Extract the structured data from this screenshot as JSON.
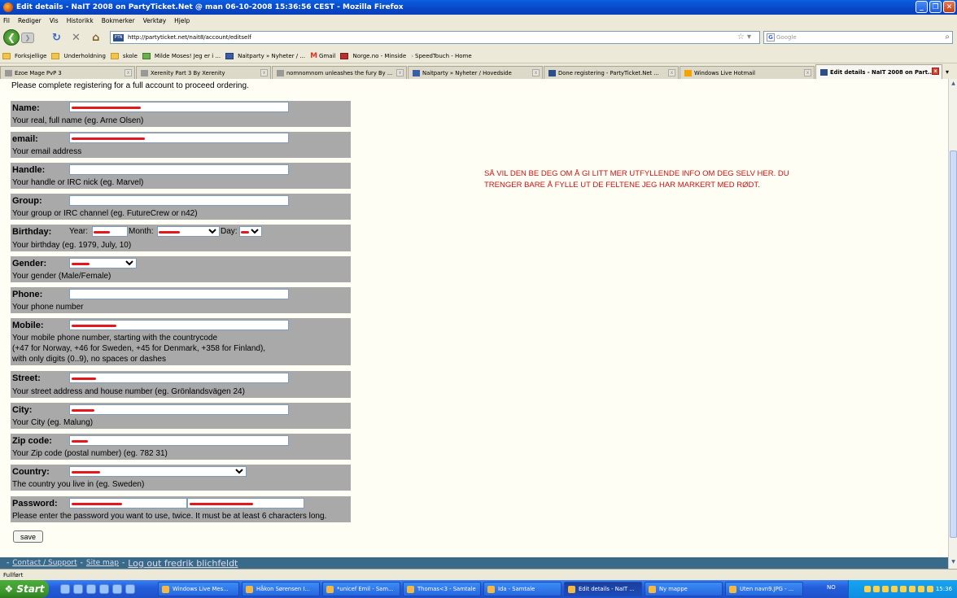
{
  "window": {
    "title": "Edit details - NaIT 2008 on PartyTicket.Net @ man 06-10-2008 15:36:56 CEST - Mozilla Firefox"
  },
  "menu": [
    "Fil",
    "Rediger",
    "Vis",
    "Historikk",
    "Bokmerker",
    "Verktøy",
    "Hjelp"
  ],
  "nav": {
    "url": "http://partyticket.net/nait8/account/editself",
    "url_favicon": "PTN",
    "search_placeholder": "Google"
  },
  "bookmarks": [
    {
      "label": "Forksjellige",
      "icon": "folder-icon"
    },
    {
      "label": "Underholdning",
      "icon": "folder-icon"
    },
    {
      "label": "skole",
      "icon": "folder-icon"
    },
    {
      "label": "Milde Moses! Jeg er i ...",
      "icon": "page-icon"
    },
    {
      "label": "Naitparty » Nyheter / ...",
      "icon": "page-icon"
    },
    {
      "label": "Gmail",
      "icon": "gmail-icon"
    },
    {
      "label": "Norge.no - Minside",
      "icon": "page-icon"
    },
    {
      "label": "SpeedTouch - Home",
      "icon": "page-icon"
    }
  ],
  "tabs": [
    {
      "label": "Ezoe Mage PvP 3"
    },
    {
      "label": "Xerenity Part 3 By Xerenity"
    },
    {
      "label": "nomnomnom unleashes the fury By ..."
    },
    {
      "label": "Naitparty » Nyheter / Hovedside"
    },
    {
      "label": "Done registering - PartyTicket.Net ..."
    },
    {
      "label": "Windows Live Hotmail"
    },
    {
      "label": "Edit details - NaIT 2008 on Part..."
    }
  ],
  "page": {
    "intro": "Please complete registering for a full account to proceed ordering.",
    "fields": {
      "name": {
        "label": "Name:",
        "help": "Your real, full name (eg. Arne Olsen)"
      },
      "email": {
        "label": "email:",
        "help": "Your email address"
      },
      "handle": {
        "label": "Handle:",
        "help": "Your handle or IRC nick (eg. Marvel)"
      },
      "group": {
        "label": "Group:",
        "help": "Your group or IRC channel (eg. FutureCrew or n42)"
      },
      "birthday": {
        "label": "Birthday:",
        "help": "Your birthday (eg. 1979, July, 10)",
        "year_label": "Year:",
        "month_label": "Month:",
        "day_label": "Day:"
      },
      "gender": {
        "label": "Gender:",
        "help": "Your gender (Male/Female)"
      },
      "phone": {
        "label": "Phone:",
        "help": "Your phone number"
      },
      "mobile": {
        "label": "Mobile:",
        "help_1": "Your mobile phone number, starting with the countrycode",
        "help_2": "(+47 for Norway, +46 for Sweden, +45 for Denmark, +358 for Finland),",
        "help_3": "with only digits (0..9), no spaces or dashes"
      },
      "street": {
        "label": "Street:",
        "help": "Your street address and house number (eg. Grönlandsvägen 24)"
      },
      "city": {
        "label": "City:",
        "help": "Your City (eg. Malung)"
      },
      "zip": {
        "label": "Zip code:",
        "help": "Your Zip code (postal number) (eg. 782 31)"
      },
      "country": {
        "label": "Country:",
        "help": "The country you live in (eg. Sweden)"
      },
      "password": {
        "label": "Password:",
        "help": "Please enter the password you want to use, twice. It must be at least 6 characters long."
      }
    },
    "save_label": "save",
    "note": "SÅ VIL DEN BE DEG OM Å GI LITT MER UTFYLLENDE INFO OM DEG SELV HER. DU TRENGER BARE Å FYLLE UT DE FELTENE JEG HAR MARKERT MED RØDT."
  },
  "footer": {
    "contact": "Contact / Support",
    "sitemap": "Site map",
    "logout": "Log out fredrik blichfeldt"
  },
  "status": "Fullført",
  "taskbar": {
    "start": "Start",
    "items": [
      "Windows Live Mes...",
      "Håkon Sørensen I...",
      "*unicef Emil - Sam...",
      "Thomas<3 - Samtale",
      "Ida - Samtale",
      "Edit details - NaIT ...",
      "Ny mappe",
      "Uten navn9.JPG - ..."
    ],
    "lang": "NO",
    "clock": "15:36"
  },
  "colors": {
    "field_bg": "#a9a9a9",
    "note_text": "#d11010",
    "redaction": "#e4171d",
    "footer_bg": "#3a6a8a"
  }
}
